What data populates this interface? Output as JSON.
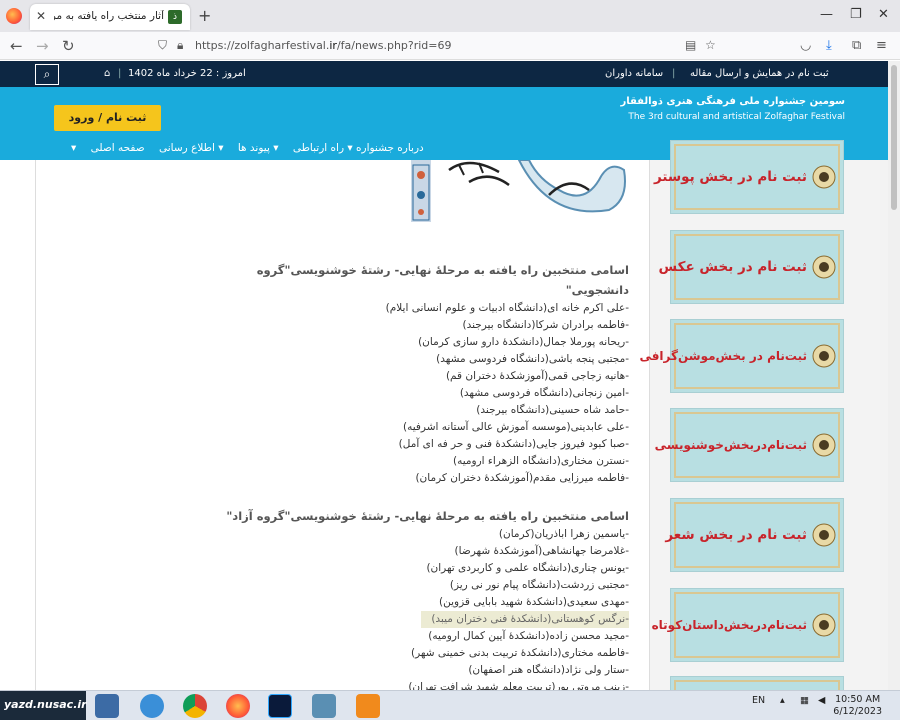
{
  "browser": {
    "tab_title": "آثار منتخب راه یافته به مرحلهٔ نهایی",
    "tab_favicon": "ذ",
    "url_prefix": "https://zolfagharfestival.",
    "url_domain": "ir",
    "url_path": "/fa/news.php?rid=69"
  },
  "site": {
    "top_links": {
      "register_submit": "ثبت نام در همایش و ارسال مقاله",
      "judges_system": "سامانه داوران",
      "date": "امروز : 22 خرداد ماه 1402"
    },
    "register_button": "ثبت نام / ورود",
    "title_fa": "سومین جشنواره ملی فرهنگی هنری ذوالفقار",
    "title_en": "The 3rd cultural and artistical Zolfaghar Festival",
    "menu": [
      "صفحه اصلی",
      "اطلاع رسانی",
      "پیوند ها",
      "راه ارتباطی",
      "درباره جشنواره"
    ]
  },
  "article": {
    "heading1": "اسامی منتخبین راه یافته به مرحلهٔ نهایی- رشتهٔ خوشنویسی\"گروه دانشجویی\"",
    "list1": [
      "-علی اکرم خانه ای(دانشگاه ادبیات و علوم انسانی ایلام)",
      "-فاطمه برادران شرکا(دانشگاه بیرجند)",
      "-ریحانه پورملا جمال(دانشکدهٔ دارو سازی کرمان)",
      "-مجتبی پنجه باشی(دانشگاه فردوسی مشهد)",
      "-هانیه زجاجی قمی(آموزشکدهٔ دختران قم)",
      "-امین زنجانی(دانشگاه فردوسی مشهد)",
      "-حامد شاه حسینی(دانشگاه بیرجند)",
      "-علی عابدینی(موسسه آموزش عالی آستانه اشرفیه)",
      "-صبا کبود فیروز جایی(دانشکدهٔ فنی و حر فه ای آمل)",
      "-نسترن مختاری(دانشگاه الزهراء ارومیه)",
      "-فاطمه میرزایی مقدم(آموزشکدهٔ دختران کرمان)"
    ],
    "heading2": "اسامی منتخبین راه یافته به مرحلهٔ نهایی- رشتهٔ خوشنویسی\"گروه آزاد\"",
    "list2": [
      "-یاسمین زهرا اباذریان(کرمان)",
      "-غلامرضا جهانشاهی(آموزشکدهٔ شهرضا)",
      "-یونس چناری(دانشگاه علمی و کاربردی تهران)",
      "-مجتبی زردشت(دانشگاه پیام نور نی ریز)",
      "-مهدی سعیدی(دانشکدهٔ شهید بابایی قزوین)",
      "-نرگس کوهستانی(دانشکدهٔ فنی دختران میبد)",
      "-مجید محسن زاده(دانشکدهٔ آیین کمال ارومیه)",
      "-فاطمه مختاری(دانشکدهٔ تربیت بدنی خمینی شهر)",
      "-ستار ولی نژاد(دانشگاه هنر اصفهان)",
      "-زینب مروتی پور(تربیت معلم شهید شرافت تهران)"
    ]
  },
  "sidebar_ads": [
    "ثبت نام در بخش پوستر",
    "ثبت نام در بخش عکس",
    "ثبت‌نام در بخش‌موشن‌گرافی",
    "ثبت‌نام‌در‌بخش‌خوشنویسی",
    "ثبت نام در بخش شعر",
    "ثبت‌نام‌در‌بخش‌داستان‌کوتاه"
  ],
  "taskbar": {
    "start_label": "yazd.nusac.ir",
    "lang": "EN",
    "time": "10:50 AM",
    "date": "6/12/2023"
  },
  "colors": {
    "header_dark": "#0d2743",
    "header_blue": "#1aabdc",
    "register_yellow": "#f5c51c",
    "ad_red": "#c8242b"
  }
}
